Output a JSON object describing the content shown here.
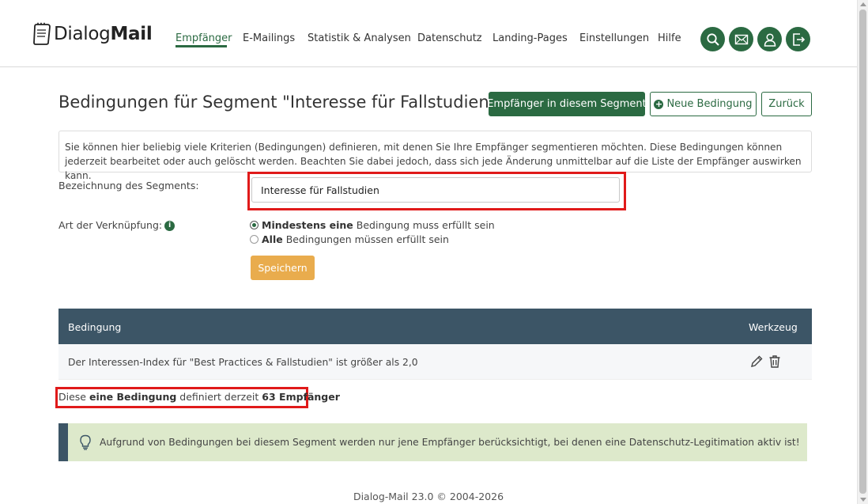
{
  "header": {
    "logo_text_light": "Dialog",
    "logo_text_bold": "Mail",
    "nav": [
      {
        "label": "Empfänger",
        "active": true
      },
      {
        "label": "E-Mailings"
      },
      {
        "label": "Statistik & Analysen"
      },
      {
        "label": "Datenschutz"
      },
      {
        "label": "Landing-Pages"
      },
      {
        "label": "Einstellungen"
      },
      {
        "label": "Hilfe"
      }
    ],
    "icons": [
      "search-icon",
      "mail-icon",
      "user-icon",
      "logout-icon"
    ],
    "accent_color": "#2b6a42"
  },
  "page": {
    "title": "Bedingungen für Segment \"Interesse für Fallstudien\"",
    "buttons": {
      "recipients": "Empfänger in diesem Segment",
      "new_condition": "Neue Bedingung",
      "back": "Zurück"
    },
    "info_text": "Sie können hier beliebig viele Kriterien (Bedingungen) definieren, mit denen Sie Ihre Empfänger segmentieren möchten. Diese Bedingungen können jederzeit bearbeitet oder auch gelöscht werden. Beachten Sie dabei jedoch, dass sich jede Änderung unmittelbar auf die Liste der Empfänger auswirken kann."
  },
  "form": {
    "segment_label": "Bezeichnung des Segments:",
    "segment_value": "Interesse für Fallstudien",
    "link_label": "Art der Verknüpfung:",
    "options": [
      {
        "bold": "Mindestens eine",
        "rest": "Bedingung muss erfüllt sein",
        "checked": true
      },
      {
        "bold": "Alle",
        "rest": "Bedingungen müssen erfüllt sein",
        "checked": false
      }
    ],
    "save_label": "Speichern",
    "save_color": "#e9ac4d"
  },
  "table": {
    "headers": {
      "condition": "Bedingung",
      "tool": "Werkzeug"
    },
    "rows": [
      {
        "condition": "Der Interessen-Index für \"Best Practices & Fallstudien\" ist größer als 2,0"
      }
    ],
    "header_color": "#3c5566"
  },
  "summary": {
    "prefix": "Diese",
    "bold1": "eine Bedingung",
    "middle": "definiert derzeit",
    "bold2": "63 Empfänger"
  },
  "notice": {
    "text": "Aufgrund von Bedingungen bei diesem Segment werden nur jene Empfänger berücksichtigt, bei denen eine Datenschutz-Legitimation aktiv ist!",
    "icon": "lightbulb-icon"
  },
  "footer": {
    "text": "Dialog-Mail 23.0 © 2004-2026"
  }
}
